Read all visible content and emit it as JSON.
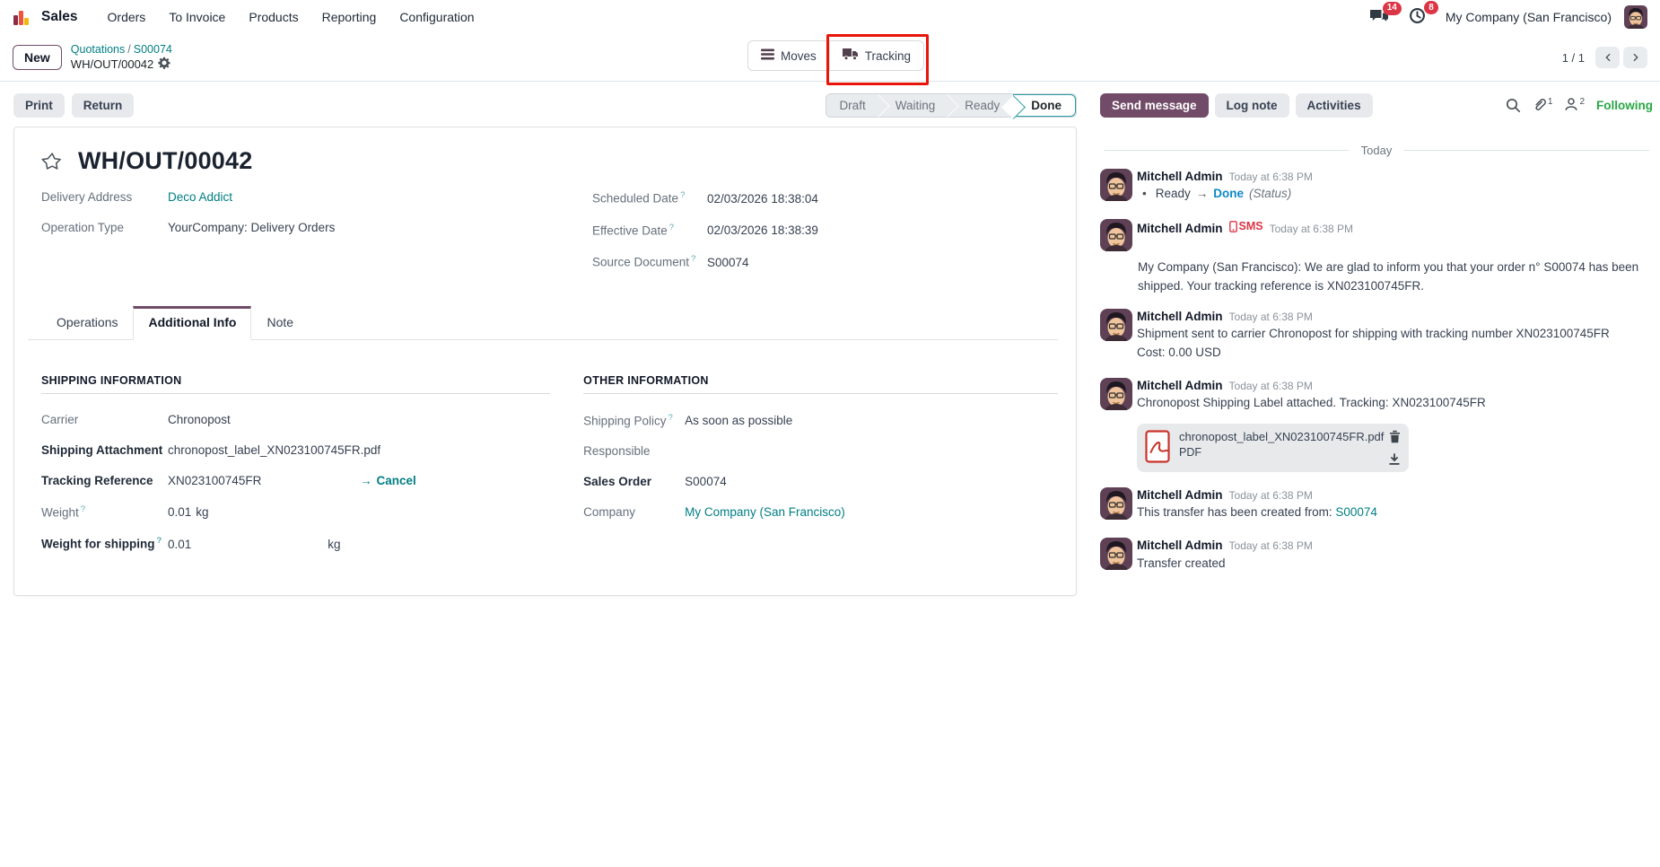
{
  "colors": {
    "accent": "#714B67",
    "link": "#017E84",
    "success": "#28a745",
    "danger": "#dc3545",
    "highlight": "#e8150b",
    "info": "#0e87c5",
    "done": "#2d9da3"
  },
  "navbar": {
    "app": "Sales",
    "menu": [
      "Orders",
      "To Invoice",
      "Products",
      "Reporting",
      "Configuration"
    ],
    "messages_badge": "14",
    "activities_badge": "8",
    "company": "My Company (San Francisco)"
  },
  "control_panel": {
    "new_label": "New",
    "breadcrumb_parent": "Quotations",
    "breadcrumb_sep": "/",
    "breadcrumb_sub": "S00074",
    "record_name": "WH/OUT/00042",
    "moves_label": "Moves",
    "tracking_label": "Tracking",
    "pager": "1 / 1"
  },
  "form": {
    "print_label": "Print",
    "return_label": "Return",
    "statusbar": [
      "Draft",
      "Waiting",
      "Ready",
      "Done"
    ],
    "active_step": "Done",
    "title": "WH/OUT/00042",
    "help": "?",
    "fields": {
      "delivery_address": {
        "label": "Delivery Address",
        "value": "Deco Addict"
      },
      "operation_type": {
        "label": "Operation Type",
        "value": "YourCompany: Delivery Orders"
      },
      "scheduled_date": {
        "label": "Scheduled Date",
        "value": "02/03/2026 18:38:04"
      },
      "effective_date": {
        "label": "Effective Date",
        "value": "02/03/2026 18:38:39"
      },
      "source_document": {
        "label": "Source Document",
        "value": "S00074"
      }
    },
    "tabs": [
      "Operations",
      "Additional Info",
      "Note"
    ],
    "active_tab": "Additional Info",
    "shipping_section": {
      "heading": "SHIPPING INFORMATION",
      "carrier": {
        "label": "Carrier",
        "value": "Chronopost"
      },
      "shipping_attachment": {
        "label": "Shipping Attachment",
        "value": "chronopost_label_XN023100745FR.pdf"
      },
      "tracking_reference": {
        "label": "Tracking Reference",
        "value": "XN023100745FR",
        "action_arrow": "→",
        "action": "Cancel"
      },
      "weight": {
        "label": "Weight",
        "value": "0.01",
        "unit": "kg"
      },
      "weight_for_shipping": {
        "label": "Weight for shipping",
        "value": "0.01",
        "unit": "kg"
      }
    },
    "other_section": {
      "heading": "OTHER INFORMATION",
      "shipping_policy": {
        "label": "Shipping Policy",
        "value": "As soon as possible"
      },
      "responsible": {
        "label": "Responsible",
        "value": ""
      },
      "sales_order": {
        "label": "Sales Order",
        "value": "S00074"
      },
      "company": {
        "label": "Company",
        "value": "My Company (San Francisco)"
      }
    }
  },
  "chatter": {
    "send_message": "Send message",
    "log_note": "Log note",
    "activities": "Activities",
    "attachments_count": "1",
    "followers_count": "2",
    "following": "Following",
    "day_divider": "Today",
    "messages": [
      {
        "author": "Mitchell Admin",
        "time": "Today at 6:38 PM",
        "bullet": "•",
        "change_from": "Ready",
        "arrow": "→",
        "change_to": "Done",
        "change_field": "(Status)"
      },
      {
        "author": "Mitchell Admin",
        "badge": "SMS",
        "time": "Today at 6:38 PM",
        "body": "My Company (San Francisco): We are glad to inform you that your order n° S00074 has been shipped. Your tracking reference is XN023100745FR."
      },
      {
        "author": "Mitchell Admin",
        "time": "Today at 6:38 PM",
        "body": "Shipment sent to carrier Chronopost for shipping with tracking number XN023100745FR",
        "body2": "Cost: 0.00 USD"
      },
      {
        "author": "Mitchell Admin",
        "time": "Today at 6:38 PM",
        "body": "Chronopost Shipping Label attached. Tracking: XN023100745FR",
        "attachment_name": "chronopost_label_XN023100745FR.pdf",
        "attachment_type": "PDF"
      },
      {
        "author": "Mitchell Admin",
        "time": "Today at 6:38 PM",
        "body": "This transfer has been created from: ",
        "link": "S00074"
      },
      {
        "author": "Mitchell Admin",
        "time": "Today at 6:38 PM",
        "body": "Transfer created"
      }
    ]
  }
}
